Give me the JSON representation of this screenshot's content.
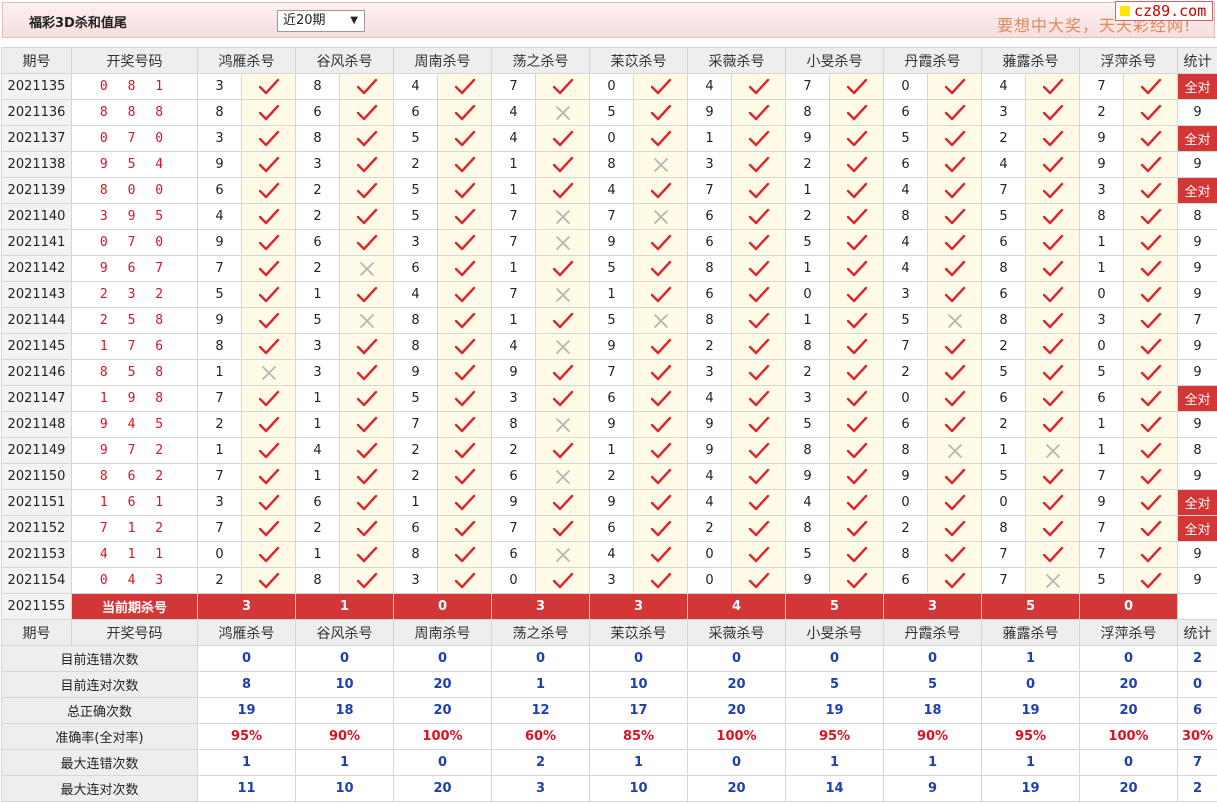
{
  "header": {
    "brand": "福彩3D杀和值尾",
    "period": "近20期",
    "slogan": "要想中大奖，天天彩经网!",
    "logo": "cz89.com"
  },
  "columns": {
    "issue": "期号",
    "draw": "开奖号码",
    "stat": "统计",
    "experts": [
      "鸿雁杀号",
      "谷风杀号",
      "周南杀号",
      "荡之杀号",
      "苿苡杀号",
      "采薇杀号",
      "小旻杀号",
      "丹霞杀号",
      "蕥露杀号",
      "浮萍杀号"
    ]
  },
  "rows": [
    {
      "issue": "2021135",
      "draw": "0 8 1",
      "kills": [
        "3",
        "8",
        "4",
        "7",
        "0",
        "4",
        "7",
        "0",
        "4",
        "7"
      ],
      "marks": "1111111111",
      "stat": "全对"
    },
    {
      "issue": "2021136",
      "draw": "8 8 8",
      "kills": [
        "8",
        "6",
        "6",
        "4",
        "5",
        "9",
        "8",
        "6",
        "3",
        "2"
      ],
      "marks": "1110111111",
      "stat": "9"
    },
    {
      "issue": "2021137",
      "draw": "0 7 0",
      "kills": [
        "3",
        "8",
        "5",
        "4",
        "0",
        "1",
        "9",
        "5",
        "2",
        "9"
      ],
      "marks": "1111111111",
      "stat": "全对"
    },
    {
      "issue": "2021138",
      "draw": "9 5 4",
      "kills": [
        "9",
        "3",
        "2",
        "1",
        "8",
        "3",
        "2",
        "6",
        "4",
        "9"
      ],
      "marks": "1111011111",
      "stat": "9"
    },
    {
      "issue": "2021139",
      "draw": "8 0 0",
      "kills": [
        "6",
        "2",
        "5",
        "1",
        "4",
        "7",
        "1",
        "4",
        "7",
        "3"
      ],
      "marks": "1111111111",
      "stat": "全对"
    },
    {
      "issue": "2021140",
      "draw": "3 9 5",
      "kills": [
        "4",
        "2",
        "5",
        "7",
        "7",
        "6",
        "2",
        "8",
        "5",
        "8"
      ],
      "marks": "1110011111",
      "stat": "8"
    },
    {
      "issue": "2021141",
      "draw": "0 7 0",
      "kills": [
        "9",
        "6",
        "3",
        "7",
        "9",
        "6",
        "5",
        "4",
        "6",
        "1"
      ],
      "marks": "1110111111",
      "stat": "9"
    },
    {
      "issue": "2021142",
      "draw": "9 6 7",
      "kills": [
        "7",
        "2",
        "6",
        "1",
        "5",
        "8",
        "1",
        "4",
        "8",
        "1"
      ],
      "marks": "1011111111",
      "stat": "9"
    },
    {
      "issue": "2021143",
      "draw": "2 3 2",
      "kills": [
        "5",
        "1",
        "4",
        "7",
        "1",
        "6",
        "0",
        "3",
        "6",
        "0"
      ],
      "marks": "1110111111",
      "stat": "9"
    },
    {
      "issue": "2021144",
      "draw": "2 5 8",
      "kills": [
        "9",
        "5",
        "8",
        "1",
        "5",
        "8",
        "1",
        "5",
        "8",
        "3"
      ],
      "marks": "1011011011",
      "stat": "7"
    },
    {
      "issue": "2021145",
      "draw": "1 7 6",
      "kills": [
        "8",
        "3",
        "8",
        "4",
        "9",
        "2",
        "8",
        "7",
        "2",
        "0"
      ],
      "marks": "1110111111",
      "stat": "9"
    },
    {
      "issue": "2021146",
      "draw": "8 5 8",
      "kills": [
        "1",
        "3",
        "9",
        "9",
        "7",
        "3",
        "2",
        "2",
        "5",
        "5"
      ],
      "marks": "0111111111",
      "stat": "9"
    },
    {
      "issue": "2021147",
      "draw": "1 9 8",
      "kills": [
        "7",
        "1",
        "5",
        "3",
        "6",
        "4",
        "3",
        "0",
        "6",
        "6"
      ],
      "marks": "1111111111",
      "stat": "全对"
    },
    {
      "issue": "2021148",
      "draw": "9 4 5",
      "kills": [
        "2",
        "1",
        "7",
        "8",
        "9",
        "9",
        "5",
        "6",
        "2",
        "1"
      ],
      "marks": "1110111111",
      "stat": "9"
    },
    {
      "issue": "2021149",
      "draw": "9 7 2",
      "kills": [
        "1",
        "4",
        "2",
        "2",
        "1",
        "9",
        "8",
        "8",
        "1",
        "1"
      ],
      "marks": "1111111001",
      "stat": "8"
    },
    {
      "issue": "2021150",
      "draw": "8 6 2",
      "kills": [
        "7",
        "1",
        "2",
        "6",
        "2",
        "4",
        "9",
        "9",
        "5",
        "7"
      ],
      "marks": "1110111111",
      "stat": "9"
    },
    {
      "issue": "2021151",
      "draw": "1 6 1",
      "kills": [
        "3",
        "6",
        "1",
        "9",
        "9",
        "4",
        "4",
        "0",
        "0",
        "9"
      ],
      "marks": "1111111111",
      "stat": "全对"
    },
    {
      "issue": "2021152",
      "draw": "7 1 2",
      "kills": [
        "7",
        "2",
        "6",
        "7",
        "6",
        "2",
        "8",
        "2",
        "8",
        "7"
      ],
      "marks": "1111111111",
      "stat": "全对"
    },
    {
      "issue": "2021153",
      "draw": "4 1 1",
      "kills": [
        "0",
        "1",
        "8",
        "6",
        "4",
        "0",
        "5",
        "8",
        "7",
        "7"
      ],
      "marks": "1110111111",
      "stat": "9"
    },
    {
      "issue": "2021154",
      "draw": "0 4 3",
      "kills": [
        "2",
        "8",
        "3",
        "0",
        "3",
        "0",
        "9",
        "6",
        "7",
        "5"
      ],
      "marks": "1111111101",
      "stat": "9"
    }
  ],
  "current": {
    "issue": "2021155",
    "label": "当前期杀号",
    "kills": [
      "3",
      "1",
      "0",
      "3",
      "3",
      "4",
      "5",
      "3",
      "5",
      "0"
    ]
  },
  "stats": [
    {
      "label": "目前连错次数",
      "values": [
        "0",
        "0",
        "0",
        "0",
        "0",
        "0",
        "0",
        "0",
        "1",
        "0"
      ],
      "stat": "2"
    },
    {
      "label": "目前连对次数",
      "values": [
        "8",
        "10",
        "20",
        "1",
        "10",
        "20",
        "5",
        "5",
        "0",
        "20"
      ],
      "stat": "0"
    },
    {
      "label": "总正确次数",
      "values": [
        "19",
        "18",
        "20",
        "12",
        "17",
        "20",
        "19",
        "18",
        "19",
        "20"
      ],
      "stat": "6"
    },
    {
      "label": "准确率(全对率)",
      "values": [
        "95%",
        "90%",
        "100%",
        "60%",
        "85%",
        "100%",
        "95%",
        "90%",
        "95%",
        "100%"
      ],
      "stat": "30%",
      "rate": true
    },
    {
      "label": "最大连错次数",
      "values": [
        "1",
        "1",
        "0",
        "2",
        "1",
        "0",
        "1",
        "1",
        "1",
        "0"
      ],
      "stat": "7"
    },
    {
      "label": "最大连对次数",
      "values": [
        "11",
        "10",
        "20",
        "3",
        "10",
        "20",
        "14",
        "9",
        "19",
        "20"
      ],
      "stat": "2"
    }
  ],
  "colors": {
    "accent": "#d23636",
    "check": "#e0242f",
    "cross": "#b5b5b5",
    "stat_blue": "#1d3fb3"
  }
}
